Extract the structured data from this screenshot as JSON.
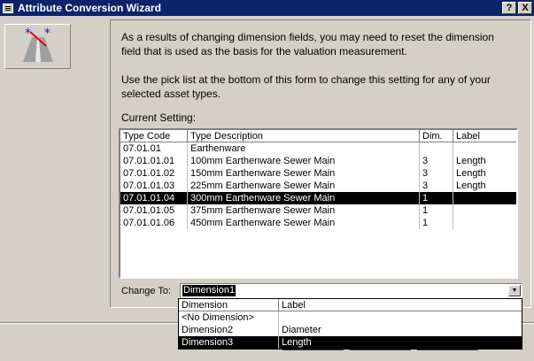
{
  "window": {
    "title": "Attribute Conversion Wizard",
    "help_btn": "?",
    "close_btn": "X"
  },
  "intro": {
    "para1": "As a results of changing dimension fields, you may need to reset the dimension field that is used as the basis for the valuation measurement.",
    "para2": "Use the pick list at the bottom of this form to change this setting for any of your selected asset types.",
    "current_setting_label": "Current Setting:"
  },
  "list": {
    "headers": [
      "Type Code",
      "Type Description",
      "Dim.",
      "Label"
    ],
    "rows": [
      [
        "07.01.01",
        "Earthenware",
        "",
        ""
      ],
      [
        "07.01.01.01",
        "100mm Earthenware Sewer Main",
        "3",
        "Length"
      ],
      [
        "07.01.01.02",
        "150mm Earthenware Sewer Main",
        "3",
        "Length"
      ],
      [
        "07.01.01.03",
        "225mm Earthenware Sewer Main",
        "3",
        "Length"
      ],
      [
        "07.01.01.04",
        "300mm Earthenware Sewer Main",
        "1",
        ""
      ],
      [
        "07.01.01.05",
        "375mm Earthenware Sewer Main",
        "1",
        ""
      ],
      [
        "07.01.01.06",
        "450mm Earthenware Sewer Main",
        "1",
        ""
      ]
    ],
    "selected_index": 4
  },
  "change_to": {
    "label": "Change To:",
    "value": "Dimension1",
    "arrow": "▼"
  },
  "dropdown": {
    "headers": [
      "Dimension",
      "Label"
    ],
    "rows": [
      [
        "<No Dimension>",
        ""
      ],
      [
        "Dimension2",
        "Diameter"
      ],
      [
        "Dimension3",
        "Length"
      ]
    ],
    "selected_index": 2
  }
}
